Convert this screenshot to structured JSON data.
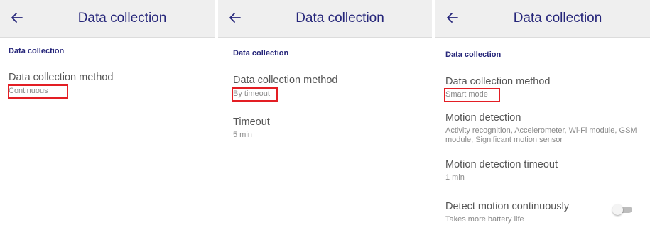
{
  "panels": [
    {
      "title": "Data collection",
      "section": "Data collection",
      "method": {
        "title": "Data collection method",
        "value": "Continuous"
      }
    },
    {
      "title": "Data collection",
      "section": "Data collection",
      "method": {
        "title": "Data collection method",
        "value": "By timeout"
      },
      "timeout": {
        "title": "Timeout",
        "value": "5 min"
      }
    },
    {
      "title": "Data collection",
      "section": "Data collection",
      "method": {
        "title": "Data collection method",
        "value": "Smart mode"
      },
      "motion": {
        "title": "Motion detection",
        "value": "Activity recognition, Accelerometer, Wi-Fi module, GSM module, Significant motion sensor"
      },
      "motion_timeout": {
        "title": "Motion detection timeout",
        "value": "1 min"
      },
      "detect_continuously": {
        "title": "Detect motion continuously",
        "value": "Takes more battery life",
        "enabled": false
      }
    }
  ],
  "colors": {
    "accent": "#26267a",
    "highlight": "#e31e24",
    "appbar": "#efefef"
  },
  "icons": {
    "back": "arrow-left-icon"
  }
}
